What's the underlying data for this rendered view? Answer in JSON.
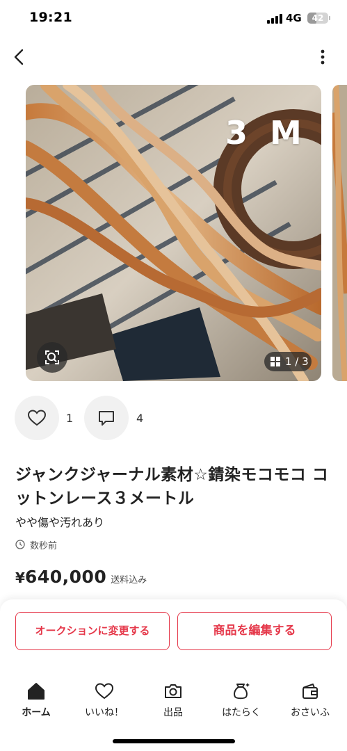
{
  "status_bar": {
    "time": "19:21",
    "network": "4G",
    "battery": "42",
    "battery_level_percent": 42
  },
  "nav": {
    "back_icon": "chevron-left-icon",
    "more_icon": "more-vertical-icon"
  },
  "gallery": {
    "overlay_label": "3 M",
    "counter": "1 / 3",
    "zoom_icon": "zoom-scan-icon",
    "counter_icon": "grid-icon"
  },
  "actions": {
    "like_count": "1",
    "comment_count": "4",
    "like_icon": "heart-icon",
    "comment_icon": "comment-icon"
  },
  "item": {
    "title": "ジャンクジャーナル素材☆錆染モコモコ コットンレース３メートル",
    "condition": "やや傷や汚れあり",
    "listed_time": "数秒前",
    "price_symbol": "¥",
    "price": "640,000",
    "shipping_note": "送料込み"
  },
  "buttons": {
    "auction": "オークションに変更する",
    "edit": "商品を編集する"
  },
  "tabs": [
    {
      "label": "ホーム",
      "icon": "home-icon",
      "active": true
    },
    {
      "label": "いいね！",
      "icon": "heart-icon",
      "active": false
    },
    {
      "label": "出品",
      "icon": "camera-icon",
      "active": false
    },
    {
      "label": "はたらく",
      "icon": "money-bag-icon",
      "active": false
    },
    {
      "label": "おさいふ",
      "icon": "wallet-icon",
      "active": false
    }
  ],
  "colors": {
    "accent": "#e5384a",
    "text": "#222222",
    "muted_bg": "#f1f1f1"
  }
}
